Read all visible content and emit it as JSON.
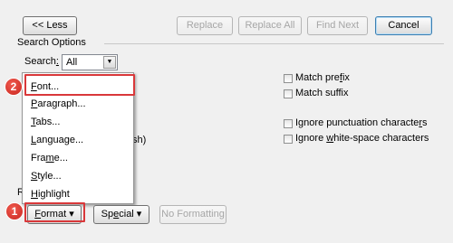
{
  "toolbar": {
    "less_label": "<< Less",
    "replace_label": "Replace",
    "replace_all_label": "Replace All",
    "find_next_label": "Find Next",
    "cancel_label": "Cancel"
  },
  "search_options": {
    "group_title": "Search Options",
    "search_label": "Search:",
    "search_value": "All"
  },
  "checkboxes_right": [
    {
      "label": "Match prefix",
      "checked": false
    },
    {
      "label": "Match suffix",
      "checked": false
    },
    {
      "label": "Ignore punctuation characters",
      "checked": false
    },
    {
      "label": "Ignore white-space characters",
      "checked": false
    }
  ],
  "partial_text": {
    "behind_menu": "sh)",
    "replace_group_fragment": "Re"
  },
  "format_menu": {
    "items": [
      "Font...",
      "Paragraph...",
      "Tabs...",
      "Language...",
      "Frame...",
      "Style...",
      "Highlight"
    ]
  },
  "bottom_buttons": {
    "format_label": "Format",
    "special_label": "Special",
    "no_formatting_label": "No Formatting"
  },
  "callouts": {
    "badge1": "1",
    "badge2": "2"
  },
  "colors": {
    "highlight": "#d9383a",
    "badge": "#d6322a",
    "dialog_bg": "#f0f0f0"
  }
}
